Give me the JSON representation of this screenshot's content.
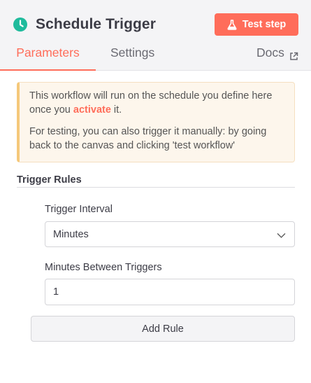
{
  "header": {
    "title": "Schedule Trigger",
    "node_icon": "clock-icon",
    "test_button": {
      "label": "Test step",
      "icon": "flask-icon"
    }
  },
  "tabs": [
    {
      "label": "Parameters",
      "active": true
    },
    {
      "label": "Settings",
      "active": false
    },
    {
      "label": "Docs",
      "icon": "external-link-icon",
      "active": false
    }
  ],
  "notice": {
    "line1_pre": "This workflow will run on the schedule you define here once you ",
    "line1_link": "activate",
    "line1_post": " it.",
    "line2": "For testing, you can also trigger it manually: by going back to the canvas and clicking 'test workflow'"
  },
  "section": {
    "title": "Trigger Rules"
  },
  "fields": {
    "interval": {
      "label": "Trigger Interval",
      "value": "Minutes"
    },
    "minutes": {
      "label": "Minutes Between Triggers",
      "value": "1"
    }
  },
  "add_rule": {
    "label": "Add Rule"
  },
  "colors": {
    "accent": "#ff6d5a",
    "node_icon": "#1fbb9c",
    "notice_bar": "#f5c87a"
  }
}
